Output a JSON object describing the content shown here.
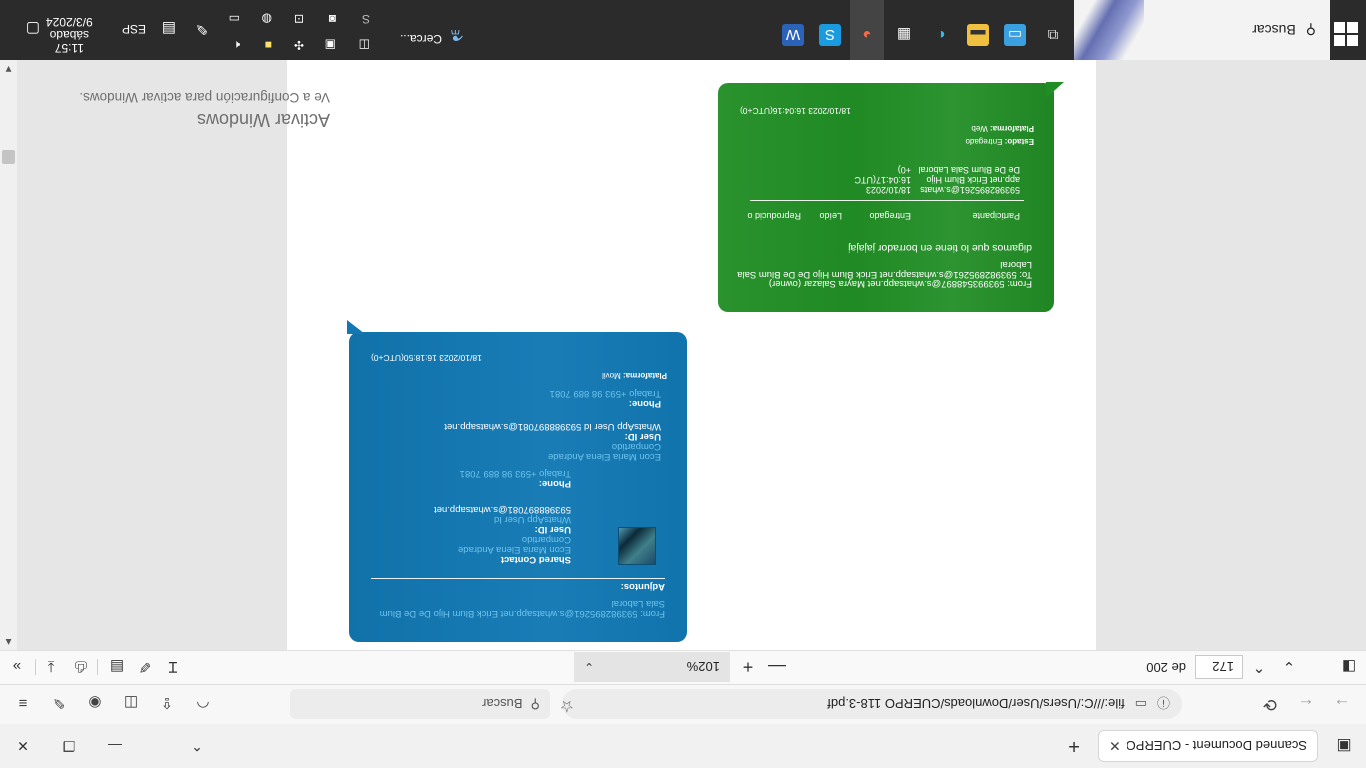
{
  "browser": {
    "tab_title": "Scanned Document - CUERPO 118-",
    "url": "file:///C:/Users/User/Downloads/CUERPO 118-3.pdf",
    "search_placeholder": "Buscar"
  },
  "pdf_toolbar": {
    "page_current": "172",
    "page_total": "de 200",
    "zoom": "102%"
  },
  "watermark": {
    "title": "Activar Windows",
    "subtitle": "Ve a Configuración para activar Windows."
  },
  "messages": [
    {
      "color": "#1278b3",
      "from": "From: 593982895261@s.whatsapp.net Erick Blum Hijo De De Blum Sala Laboral",
      "attachments_label": "Adjuntos:",
      "contact": {
        "title": "Shared Contact",
        "name": "Econ Maria Elena Andrade",
        "status": "Compartido",
        "userid_label": "User ID:",
        "userid_line1": "WhatsApp User Id",
        "userid_line2": "593988897081@s.whatsapp.net",
        "phone_label": "Phone:",
        "phone": "Trabajo +593 98 889 7081"
      },
      "body": {
        "name": "Econ Maria Elena Andrade",
        "status": "Compartido",
        "userid_label": "User ID:",
        "userid": "WhatsApp User Id 593988897081@s.whatsapp.net",
        "phone_label": "Phone:",
        "phone": "Trabajo +593 98 889 7081"
      },
      "platform_label": "Plataforma:",
      "platform": "Movil",
      "timestamp": "18/10/2023 16:18:50(UTC+0)"
    },
    {
      "color": "#218e25",
      "from": "From: 593993548897@s.whatsapp.net Mayra Salazar (owner)",
      "to": "To: 593982895261@s.whatsapp.net Erick Blum Hijo De De Blum Sala Laboral",
      "text": "digamos que lo tiene en borrador jajajaj",
      "table_headers": [
        "Participante",
        "Entregado",
        "Leído",
        "Reproducid o"
      ],
      "table_row": {
        "participant": "593982895261@s.whats app.net Erick Blum Hijo De De Blum Sala Laboral",
        "delivered": "18/10/2023 16:04:17(UTC +0)"
      },
      "estado_label": "Estado:",
      "estado": "Entregado",
      "platform_label": "Plataforma:",
      "platform": "Web",
      "timestamp": "18/10/2023 16:04:16(UTC+0)"
    }
  ],
  "taskbar": {
    "search_label": "Buscar",
    "cerca_label": "Cerca...",
    "language": "ESP",
    "time": "11:57",
    "day": "sábado",
    "date": "9/3/2024"
  }
}
